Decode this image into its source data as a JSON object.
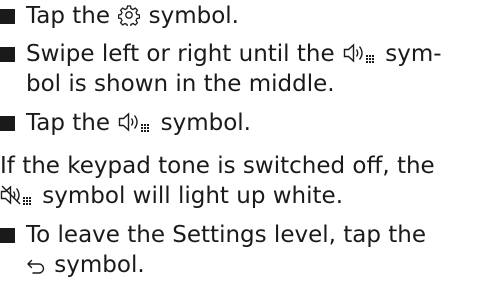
{
  "steps": [
    {
      "before": "Tap the ",
      "icon": "gear-icon",
      "after": " symbol."
    },
    {
      "before": "Swipe left or right until the ",
      "icon": "keypad-tone-icon",
      "after": " sym-",
      "continuation": "bol is shown in the middle."
    },
    {
      "before": "Tap the ",
      "icon": "keypad-tone-icon",
      "after": " symbol."
    }
  ],
  "note": {
    "line1": "If the keypad tone is switched off, the",
    "icon": "keypad-tone-muted-icon",
    "line2_after": " symbol will light up white."
  },
  "final_step": {
    "line1": "To leave the Settings level, tap the",
    "icon": "back-arrow-icon",
    "line2_after": " symbol."
  }
}
